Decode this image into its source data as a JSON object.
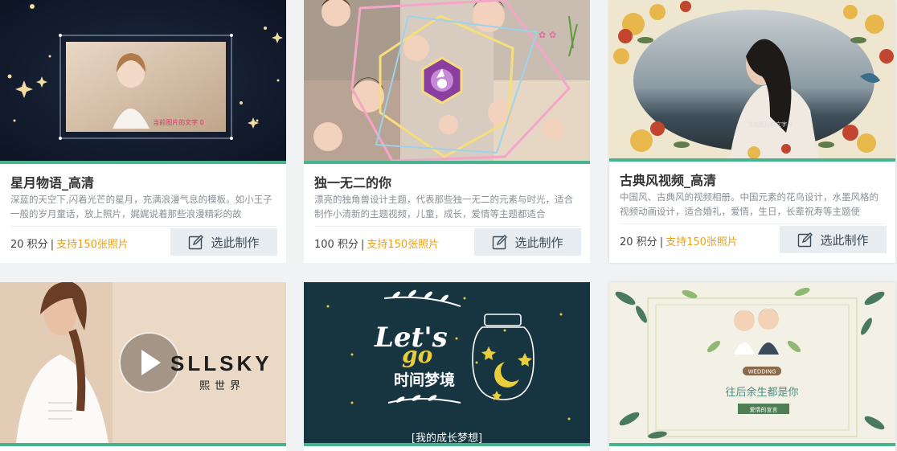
{
  "cards": [
    {
      "title": "星月物语_高清",
      "desc": "深蓝的天空下,闪着光芒的星月，充满浪漫气息的模板。如小王子一般的岁月童话，放上照片，娓娓说着那些浪漫精彩的故",
      "points": "20 积分",
      "support": "支持150张照片",
      "button": "选此制作",
      "caption": "当前图片的文字 0"
    },
    {
      "title": "独一无二的你",
      "desc": "漂亮的独角兽设计主题，代表那些独一无二的元素与时光，适合制作小清新的主题视频，儿童，成长，爱情等主题都适合",
      "points": "100 积分",
      "support": "支持150张照片",
      "button": "选此制作"
    },
    {
      "title": "古典风视频_高清",
      "desc": "中国风、古典风的视频相册。中国元素的花鸟设计，水墨风格的视频动画设计，适合婚礼，爱情，生日，长辈祝寿等主题使",
      "points": "20 积分",
      "support": "支持150张照片",
      "button": "选此制作",
      "caption": "当前图片的文字 4"
    },
    {
      "brand": "SLLSKY",
      "brand_sub": "熙世界"
    },
    {
      "lets": "Let's",
      "go": "go",
      "main": "时间梦境",
      "sub": "[我的成长梦想]"
    },
    {
      "wedding": "WEDDING",
      "line": "往后余生都是你",
      "sub": "爱情的宣言"
    }
  ],
  "colors": {
    "accent_green": "#48b48e",
    "support_orange": "#e9a11b",
    "button_bg": "#e8edf1"
  }
}
